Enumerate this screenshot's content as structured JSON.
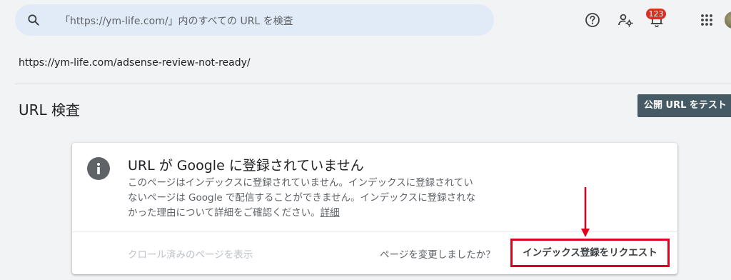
{
  "search": {
    "placeholder": "「https://ym-life.com/」内のすべての URL を検査"
  },
  "header": {
    "notifications_count": "123",
    "icons": [
      "help-icon",
      "manage-users-icon",
      "notifications-icon",
      "apps-grid-icon",
      "avatar"
    ]
  },
  "inspected_url": "https://ym-life.com/adsense-review-not-ready/",
  "page": {
    "title": "URL 検査",
    "test_live_url_button": "公開 URL をテスト"
  },
  "status_card": {
    "title": "URL が Google に登録されていません",
    "description_lines": [
      "このページはインデックスに登録されていません。インデックスに登録されてい",
      "ないページは Google で配信することができません。インデックスに登録されな",
      "かった理由について詳細をご確認ください。"
    ],
    "details_link": "詳細",
    "view_crawled_page": "クロール済みのページを表示",
    "page_changed_question": "ページを変更しましたか？",
    "request_indexing_button": "インデックス登録をリクエスト"
  },
  "colors": {
    "background": "#f1f3f4",
    "search_bar": "#e1ebf7",
    "test_button": "#455a64",
    "badge": "#d93025",
    "annotation_red": "#e0001b"
  }
}
